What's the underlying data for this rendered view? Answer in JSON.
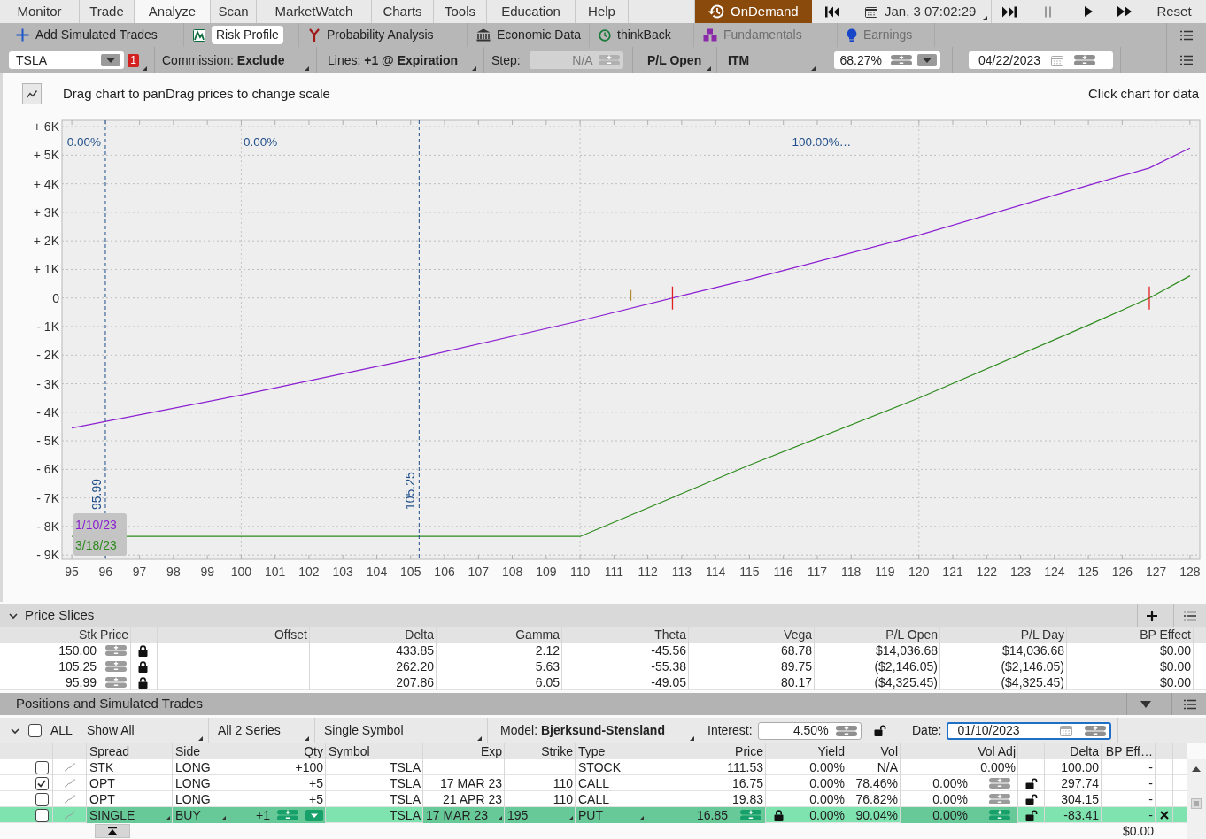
{
  "menu_tabs": [
    {
      "label": "Monitor",
      "selected": false
    },
    {
      "label": "Trade",
      "selected": false
    },
    {
      "label": "Analyze",
      "selected": true
    },
    {
      "label": "Scan",
      "selected": false
    },
    {
      "label": "MarketWatch",
      "selected": false
    },
    {
      "label": "Charts",
      "selected": false
    },
    {
      "label": "Tools",
      "selected": false
    },
    {
      "label": "Education",
      "selected": false
    },
    {
      "label": "Help",
      "selected": false
    }
  ],
  "ondemand": {
    "label": "OnDemand",
    "datetime": "Jan, 3 07:02:29",
    "reset": "Reset"
  },
  "sub_tabs": [
    {
      "label": "Add Simulated Trades",
      "selected": false,
      "disabled": false
    },
    {
      "label": "Risk Profile",
      "selected": true,
      "disabled": false
    },
    {
      "label": "Probability Analysis",
      "selected": false,
      "disabled": false
    },
    {
      "label": "Economic Data",
      "selected": false,
      "disabled": false
    },
    {
      "label": "thinkBack",
      "selected": false,
      "disabled": false
    },
    {
      "label": "Fundamentals",
      "selected": false,
      "disabled": true
    },
    {
      "label": "Earnings",
      "selected": false,
      "disabled": true
    }
  ],
  "toolbar": {
    "symbol": "TSLA",
    "alert_count": "1",
    "commission": "Commission: **Exclude**",
    "lines": "Lines: **+1 @ Expiration**",
    "step": {
      "label": "Step:",
      "value": "N/A",
      "disabled": true
    },
    "pl_mode": "P/L Open",
    "itm": "ITM",
    "probability": "68.27%",
    "date": "04/22/2023"
  },
  "chart_panel": {
    "hint": "Drag chart to panDrag prices to change scale",
    "data_hint": "Click chart for data",
    "chart_data": {
      "type": "line",
      "x": [
        95,
        100,
        105,
        110,
        113,
        115,
        120,
        125,
        126.8,
        128
      ],
      "series": [
        {
          "name": "1/10/23",
          "color": "#8b1fd1",
          "values": [
            -4550,
            -3400,
            -2150,
            -800,
            80,
            650,
            2200,
            3950,
            4550,
            5250
          ]
        },
        {
          "name": "3/18/23",
          "color": "#2e8b1e",
          "values": [
            -8350,
            -8350,
            -8350,
            -8350,
            -6850,
            -5850,
            -3500,
            -950,
            0,
            780
          ]
        }
      ],
      "xlim": [
        94.71,
        128.29
      ],
      "ylim": [
        -9150,
        6220
      ],
      "xticks": [
        95,
        96,
        97,
        98,
        99,
        100,
        101,
        102,
        103,
        104,
        105,
        106,
        107,
        108,
        109,
        110,
        111,
        112,
        113,
        114,
        115,
        116,
        117,
        118,
        119,
        120,
        121,
        122,
        123,
        124,
        125,
        126,
        127,
        128
      ],
      "yticks": [
        {
          "value": 6000,
          "label": "+ 6K"
        },
        {
          "value": 5000,
          "label": "+ 5K"
        },
        {
          "value": 4000,
          "label": "+ 4K"
        },
        {
          "value": 3000,
          "label": "+ 3K"
        },
        {
          "value": 2000,
          "label": "+ 2K"
        },
        {
          "value": 1000,
          "label": "+ 1K"
        },
        {
          "value": 0,
          "label": "0"
        },
        {
          "value": -1000,
          "label": "- 1K"
        },
        {
          "value": -2000,
          "label": "- 2K"
        },
        {
          "value": -3000,
          "label": "- 3K"
        },
        {
          "value": -4000,
          "label": "- 4K"
        },
        {
          "value": -5000,
          "label": "- 5K"
        },
        {
          "value": -6000,
          "label": "- 6K"
        },
        {
          "value": -7000,
          "label": "- 7K"
        },
        {
          "value": -8000,
          "label": "- 8K"
        },
        {
          "value": -9000,
          "label": "- 9K"
        }
      ],
      "grid": true,
      "ref_lines": [
        {
          "axis": "x",
          "value": 95.99,
          "label": "95.99",
          "color": "#1f4e8a"
        },
        {
          "axis": "x",
          "value": 105.25,
          "label": "105.25",
          "color": "#1f4e8a"
        }
      ],
      "annotations": [
        "0.00%",
        "0.00%",
        "100.00%…"
      ]
    }
  },
  "price_slices": {
    "title": "Price Slices",
    "expanded": true,
    "columns": [
      "Stk Price",
      "Offset",
      "Delta",
      "Gamma",
      "Theta",
      "Vega",
      "P/L Open",
      "P/L Day",
      "BP Effect"
    ],
    "rows": [
      {
        "stk_price": "150.00",
        "locked": true,
        "delta": "433.85",
        "gamma": "2.12",
        "theta": "-45.56",
        "vega": "68.78",
        "pl_open": "$14,036.68",
        "pl_day": "$14,036.68",
        "bp_effect": "$0.00"
      },
      {
        "stk_price": "105.25",
        "locked": true,
        "delta": "262.20",
        "gamma": "5.63",
        "theta": "-55.38",
        "vega": "89.75",
        "pl_open": "($2,146.05)",
        "pl_day": "($2,146.05)",
        "bp_effect": "$0.00"
      },
      {
        "stk_price": "95.99",
        "locked": true,
        "delta": "207.86",
        "gamma": "6.05",
        "theta": "-49.05",
        "vega": "80.17",
        "pl_open": "($4,325.45)",
        "pl_day": "($4,325.45)",
        "bp_effect": "$0.00"
      }
    ]
  },
  "positions": {
    "title": "Positions and Simulated Trades",
    "expanded": true,
    "filters": {
      "all_label": "ALL",
      "all_checked": false,
      "show": "Show All",
      "series": "All 2 Series",
      "symbol_mode": "Single Symbol",
      "model": "Model: **Bjerksund-Stensland**",
      "interest_label": "Interest:",
      "interest": "4.50%",
      "interest_locked": false,
      "date_label": "Date:",
      "date": "01/10/2023"
    },
    "columns": [
      "Spread",
      "Side",
      "Qty",
      "Symbol",
      "Exp",
      "Strike",
      "Type",
      "Price",
      "Yield",
      "Vol",
      "Vol Adj",
      "Delta",
      "BP Eff…"
    ],
    "rows": [
      {
        "kind": "stock",
        "checked": false,
        "spread": "STK",
        "side": "LONG",
        "qty": "+100",
        "symbol": "TSLA",
        "type": "STOCK",
        "price": "111.53",
        "yield": "0.00%",
        "vol": "N/A",
        "vol_adj": "0.00%",
        "delta": "100.00",
        "bp_effect": "-"
      },
      {
        "kind": "option",
        "checked": true,
        "spread": "OPT",
        "side": "LONG",
        "qty": "+5",
        "symbol": "TSLA",
        "exp": "17 MAR 23",
        "strike": "110",
        "type": "CALL",
        "price": "16.75",
        "yield": "0.00%",
        "vol": "78.46%",
        "vol_adj": "0.00%",
        "vol_locked": false,
        "delta": "297.74",
        "bp_effect": "-"
      },
      {
        "kind": "option",
        "checked": false,
        "spread": "OPT",
        "side": "LONG",
        "qty": "+5",
        "symbol": "TSLA",
        "exp": "21 APR 23",
        "strike": "110",
        "type": "CALL",
        "price": "19.83",
        "yield": "0.00%",
        "vol": "76.82%",
        "vol_adj": "0.00%",
        "vol_locked": false,
        "delta": "304.15",
        "bp_effect": "-"
      },
      {
        "kind": "simulated",
        "checked": false,
        "spread": "SINGLE",
        "side": "BUY",
        "qty": "+1",
        "symbol": "TSLA",
        "exp": "17 MAR 23",
        "strike": "195",
        "type": "PUT",
        "price": "16.85",
        "price_locked": true,
        "yield": "0.00%",
        "vol": "90.04%",
        "vol_adj": "0.00%",
        "vol_locked": false,
        "delta": "-83.41",
        "bp_effect": "-"
      }
    ],
    "total_bp_effect": "$0.00"
  }
}
